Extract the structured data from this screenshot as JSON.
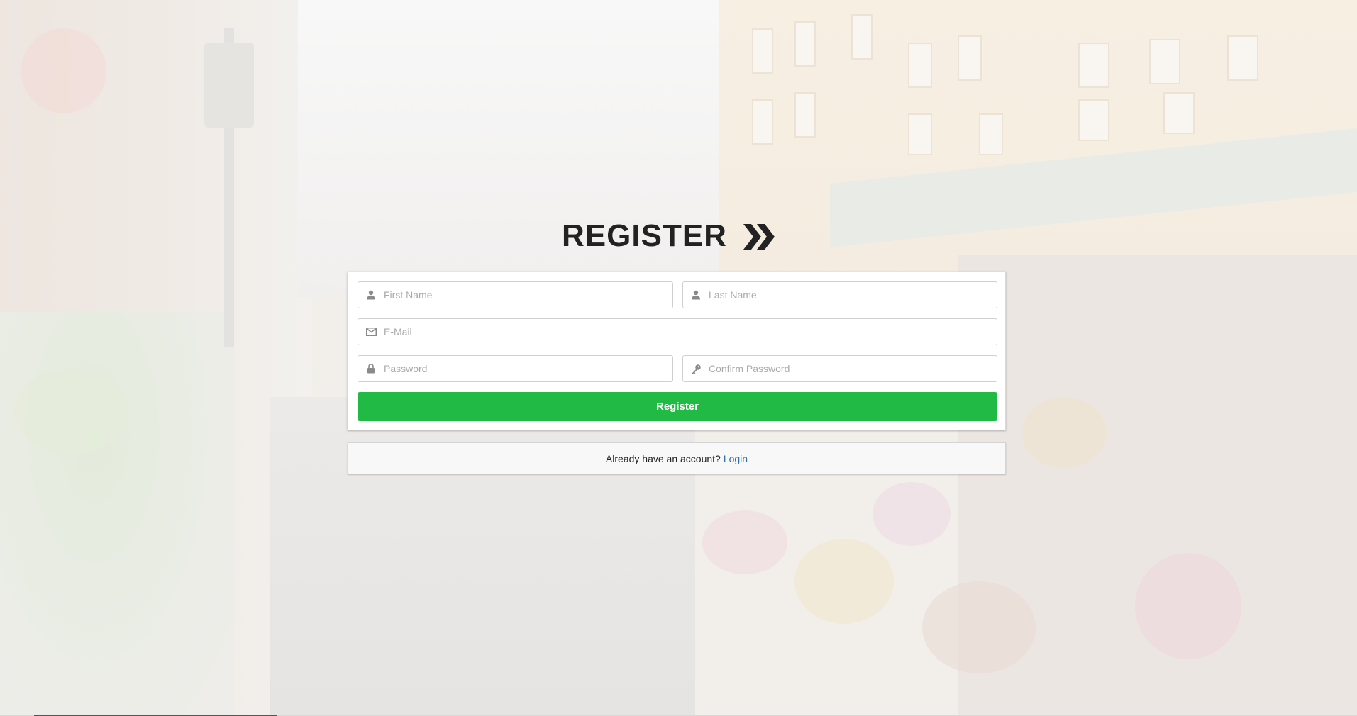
{
  "header": {
    "title": "REGISTER",
    "icon": "double-chevron-right-icon"
  },
  "form": {
    "first_name": {
      "placeholder": "First Name",
      "value": "",
      "icon": "user-icon"
    },
    "last_name": {
      "placeholder": "Last Name",
      "value": "",
      "icon": "user-icon"
    },
    "email": {
      "placeholder": "E-Mail",
      "value": "",
      "icon": "envelope-icon"
    },
    "password": {
      "placeholder": "Password",
      "value": "",
      "icon": "lock-icon"
    },
    "confirm_password": {
      "placeholder": "Confirm Password",
      "value": "",
      "icon": "key-icon"
    },
    "submit_label": "Register"
  },
  "footer": {
    "prompt": "Already have an account?",
    "login_label": "Login"
  },
  "colors": {
    "button_green": "#21ba45",
    "link_blue": "#2a6fb0",
    "title_dark": "#222222"
  }
}
